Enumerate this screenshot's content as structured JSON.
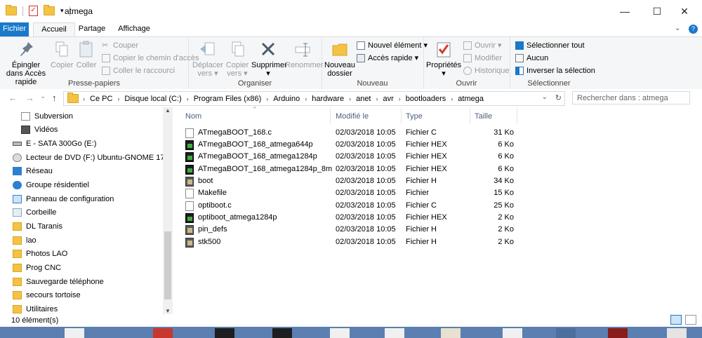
{
  "window": {
    "title": "atmega"
  },
  "controls": {
    "minimize": "—",
    "maximize": "☐",
    "close": "✕",
    "help": "?"
  },
  "tabs": [
    {
      "label": "Fichier"
    },
    {
      "label": "Accueil"
    },
    {
      "label": "Partage"
    },
    {
      "label": "Affichage"
    }
  ],
  "ribbon": {
    "clipboard": {
      "label": "Presse-papiers",
      "pin": "Épingler dans Accès rapide",
      "copy": "Copier",
      "paste": "Coller",
      "cut": "Couper",
      "copy_path": "Copier le chemin d'accès",
      "paste_shortcut": "Coller le raccourci"
    },
    "organize": {
      "label": "Organiser",
      "move_l1": "Déplacer",
      "move_l2": "vers ▾",
      "copyto_l1": "Copier",
      "copyto_l2": "vers ▾",
      "delete_l1": "Supprimer",
      "delete_l2": "▾",
      "rename": "Renommer"
    },
    "new": {
      "label": "Nouveau",
      "new_folder_l1": "Nouveau",
      "new_folder_l2": "dossier",
      "new_item": "Nouvel élément ▾",
      "quick_access": "Accès rapide ▾"
    },
    "open": {
      "label": "Ouvrir",
      "properties_l1": "Propriétés",
      "properties_l2": "▾",
      "open": "Ouvrir ▾",
      "modify": "Modifier",
      "history": "Historique"
    },
    "select": {
      "label": "Sélectionner",
      "select_all": "Sélectionner tout",
      "none": "Aucun",
      "invert": "Inverser la sélection"
    }
  },
  "nav": {
    "back": "←",
    "forward": "→",
    "up_dropdown": "⌄",
    "up": "↑",
    "breadcrumb": [
      "Ce PC",
      "Disque local (C:)",
      "Program Files (x86)",
      "Arduino",
      "hardware",
      "anet",
      "avr",
      "bootloaders",
      "atmega"
    ],
    "dropdown": "⌄",
    "refresh": "↻",
    "search_placeholder": "Rechercher dans : atmega"
  },
  "sidebar": {
    "items": [
      {
        "label": "Subversion",
        "icon": "document-icon"
      },
      {
        "label": "Vidéos",
        "icon": "video-icon"
      },
      {
        "label": "E - SATA 300Go (E:)",
        "icon": "drive-icon"
      },
      {
        "label": "Lecteur de DVD (F:) Ubuntu-GNOME 17.",
        "icon": "dvd-icon"
      },
      {
        "label": "Réseau",
        "icon": "network-icon"
      },
      {
        "label": "Groupe résidentiel",
        "icon": "homegroup-icon"
      },
      {
        "label": "Panneau de configuration",
        "icon": "control-panel-icon"
      },
      {
        "label": "Corbeille",
        "icon": "recycle-bin-icon"
      },
      {
        "label": "DL Taranis",
        "icon": "folder-icon"
      },
      {
        "label": "lao",
        "icon": "folder-icon"
      },
      {
        "label": "Photos LAO",
        "icon": "folder-icon"
      },
      {
        "label": "Prog CNC",
        "icon": "folder-icon"
      },
      {
        "label": "Sauvegarde téléphone",
        "icon": "folder-icon"
      },
      {
        "label": "secours tortoise",
        "icon": "folder-icon"
      },
      {
        "label": "Utilitaires",
        "icon": "folder-icon"
      }
    ]
  },
  "columns": {
    "name": "Nom",
    "modified": "Modifié le",
    "type": "Type",
    "size": "Taille"
  },
  "files": [
    {
      "name": "ATmegaBOOT_168.c",
      "modified": "02/03/2018 10:05",
      "type": "Fichier C",
      "size": "31 Ko",
      "icon": "c"
    },
    {
      "name": "ATmegaBOOT_168_atmega644p",
      "modified": "02/03/2018 10:05",
      "type": "Fichier HEX",
      "size": "6 Ko",
      "icon": "hex"
    },
    {
      "name": "ATmegaBOOT_168_atmega1284p",
      "modified": "02/03/2018 10:05",
      "type": "Fichier HEX",
      "size": "6 Ko",
      "icon": "hex"
    },
    {
      "name": "ATmegaBOOT_168_atmega1284p_8m",
      "modified": "02/03/2018 10:05",
      "type": "Fichier HEX",
      "size": "6 Ko",
      "icon": "hex"
    },
    {
      "name": "boot",
      "modified": "02/03/2018 10:05",
      "type": "Fichier H",
      "size": "34 Ko",
      "icon": "h"
    },
    {
      "name": "Makefile",
      "modified": "02/03/2018 10:05",
      "type": "Fichier",
      "size": "15 Ko",
      "icon": "plain"
    },
    {
      "name": "optiboot.c",
      "modified": "02/03/2018 10:05",
      "type": "Fichier C",
      "size": "25 Ko",
      "icon": "c"
    },
    {
      "name": "optiboot_atmega1284p",
      "modified": "02/03/2018 10:05",
      "type": "Fichier HEX",
      "size": "2 Ko",
      "icon": "hex"
    },
    {
      "name": "pin_defs",
      "modified": "02/03/2018 10:05",
      "type": "Fichier H",
      "size": "2 Ko",
      "icon": "h"
    },
    {
      "name": "stk500",
      "modified": "02/03/2018 10:05",
      "type": "Fichier H",
      "size": "2 Ko",
      "icon": "h"
    }
  ],
  "status": {
    "count": "10 élément(s)"
  },
  "colors": {
    "accent": "#1979ca",
    "folder": "#f5c343",
    "header_text": "#4c607a"
  }
}
